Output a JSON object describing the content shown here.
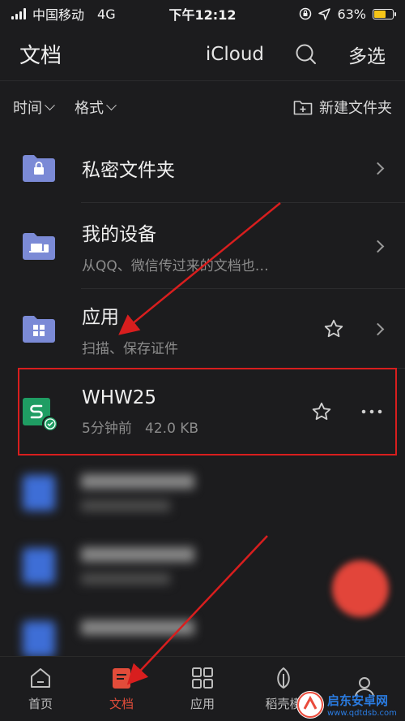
{
  "status_bar": {
    "carrier": "中国移动",
    "network": "4G",
    "time": "下午12:12",
    "battery_percent": "63%",
    "battery_level": 0.63
  },
  "header": {
    "title": "文档",
    "icloud_label": "iCloud",
    "multiselect_label": "多选"
  },
  "toolbar": {
    "sort_time": "时间",
    "sort_format": "格式",
    "new_folder": "新建文件夹"
  },
  "rows": [
    {
      "name": "私密文件夹",
      "subtitle": ""
    },
    {
      "name": "我的设备",
      "subtitle": "从QQ、微信传过来的文档也…"
    },
    {
      "name": "应用",
      "subtitle": "扫描、保存证件"
    },
    {
      "name": "WHW25",
      "subtitle": "5分钟前   42.0 KB"
    }
  ],
  "tabs": [
    {
      "label": "首页"
    },
    {
      "label": "文档"
    },
    {
      "label": "应用"
    },
    {
      "label": "稻壳模"
    }
  ],
  "watermark": {
    "name": "启东安卓网",
    "url": "www.qdtdsb.com"
  },
  "colors": {
    "background": "#1c1c1e",
    "folder": "#7b8ad6",
    "doc_green": "#1f9d63",
    "accent_red": "#e24c3a",
    "annotation_red": "#d81e1e"
  }
}
